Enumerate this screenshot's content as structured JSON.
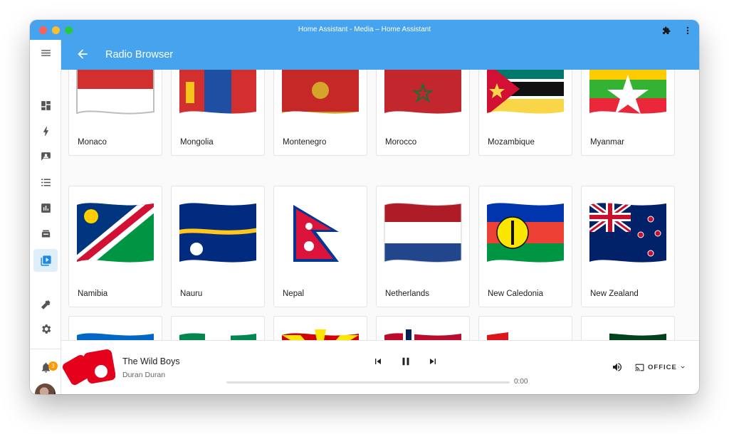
{
  "window": {
    "title": "Home Assistant - Media – Home Assistant"
  },
  "appbar": {
    "title": "Radio Browser"
  },
  "sidebar": {
    "items": [
      {
        "icon": "menu-icon"
      },
      {
        "icon": "dashboard-icon"
      },
      {
        "icon": "energy-icon"
      },
      {
        "icon": "map-icon"
      },
      {
        "icon": "logbook-icon"
      },
      {
        "icon": "history-icon"
      },
      {
        "icon": "hacs-icon"
      },
      {
        "icon": "media-icon",
        "active": true
      },
      {
        "icon": "developer-tools-icon"
      },
      {
        "icon": "settings-icon"
      }
    ],
    "notifications_count": "3"
  },
  "countries": [
    {
      "name": "Monaco"
    },
    {
      "name": "Mongolia"
    },
    {
      "name": "Montenegro"
    },
    {
      "name": "Morocco"
    },
    {
      "name": "Mozambique"
    },
    {
      "name": "Myanmar"
    },
    {
      "name": "Namibia"
    },
    {
      "name": "Nauru"
    },
    {
      "name": "Nepal"
    },
    {
      "name": "Netherlands"
    },
    {
      "name": "New Caledonia"
    },
    {
      "name": "New Zealand"
    }
  ],
  "player": {
    "track": "The Wild Boys",
    "artist": "Duran Duran",
    "time": "0:00",
    "target": "OFFICE",
    "progress": 0
  },
  "colors": {
    "accent": "#46a3ed",
    "badge": "#ff9800"
  }
}
